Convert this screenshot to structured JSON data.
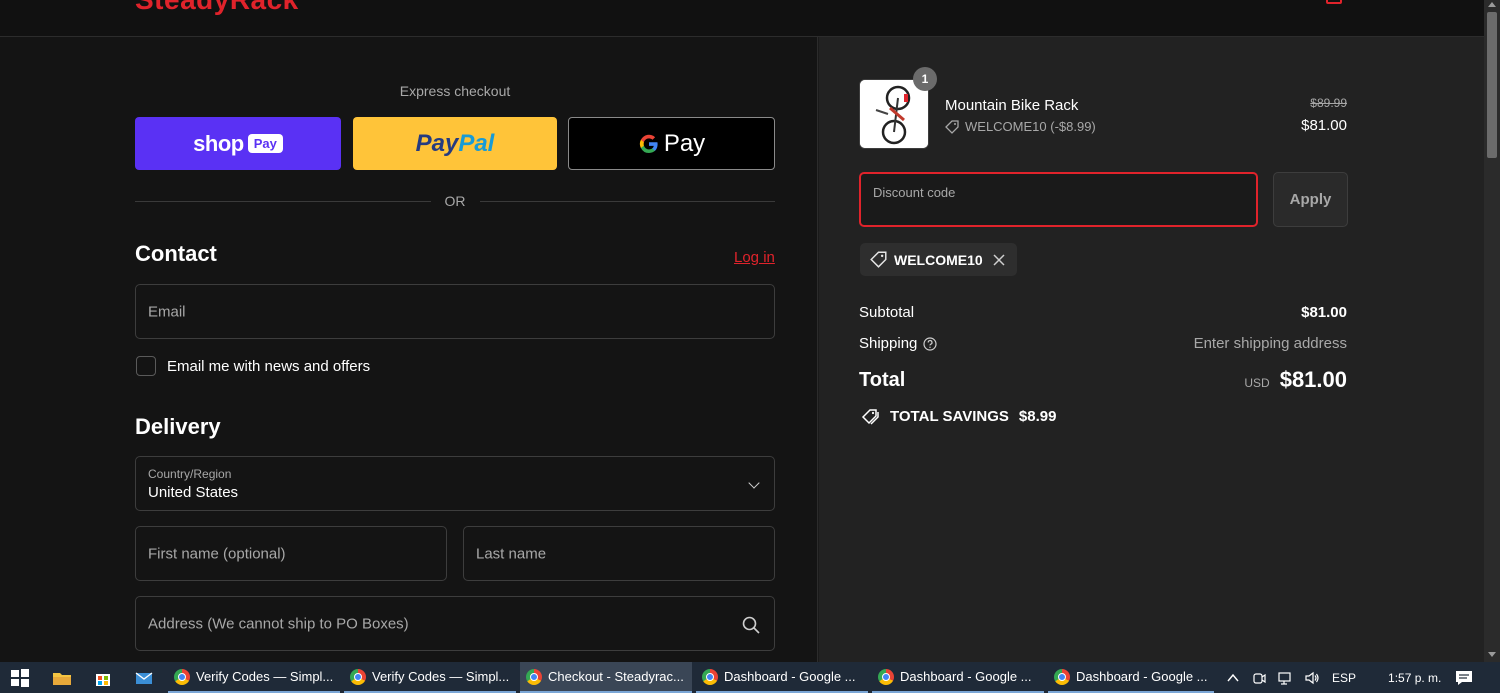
{
  "header": {
    "logo_text": "SteadyRack"
  },
  "express": {
    "title": "Express checkout",
    "shop_pay": {
      "shop": "shop",
      "pay": "Pay"
    },
    "paypal": {
      "part1": "Pay",
      "part2": "Pal"
    },
    "gpay": {
      "g": "G",
      "pay": "Pay"
    },
    "or_label": "OR"
  },
  "contact": {
    "title": "Contact",
    "login_link": "Log in",
    "email_placeholder": "Email",
    "news_label": "Email me with news and offers"
  },
  "delivery": {
    "title": "Delivery",
    "country_label": "Country/Region",
    "country_value": "United States",
    "first_name_placeholder": "First name (optional)",
    "last_name_placeholder": "Last name",
    "address_placeholder": "Address (We cannot ship to PO Boxes)"
  },
  "order": {
    "item": {
      "quantity": "1",
      "name": "Mountain Bike Rack",
      "discount_line": "WELCOME10 (-$8.99)",
      "price_original": "$89.99",
      "price_final": "$81.00"
    },
    "discount_placeholder": "Discount code",
    "apply_label": "Apply",
    "applied_code": "WELCOME10",
    "subtotal_label": "Subtotal",
    "subtotal_value": "$81.00",
    "shipping_label": "Shipping",
    "shipping_value": "Enter shipping address",
    "total_label": "Total",
    "total_currency": "USD",
    "total_value": "$81.00",
    "savings_label": "TOTAL SAVINGS",
    "savings_value": "$8.99"
  },
  "taskbar": {
    "items": [
      {
        "label": "Verify Codes — Simpl..."
      },
      {
        "label": "Verify Codes — Simpl..."
      },
      {
        "label": "Checkout - Steadyrac..."
      },
      {
        "label": "Dashboard - Google ..."
      },
      {
        "label": "Dashboard - Google ..."
      },
      {
        "label": "Dashboard - Google ..."
      }
    ],
    "language": "ESP",
    "clock": "1:57 p. m."
  },
  "colors": {
    "accent": "#e0232b",
    "shop_pay": "#5a31f4",
    "paypal": "#ffc439",
    "panel_dark": "#141414",
    "panel_summary": "#222222"
  }
}
